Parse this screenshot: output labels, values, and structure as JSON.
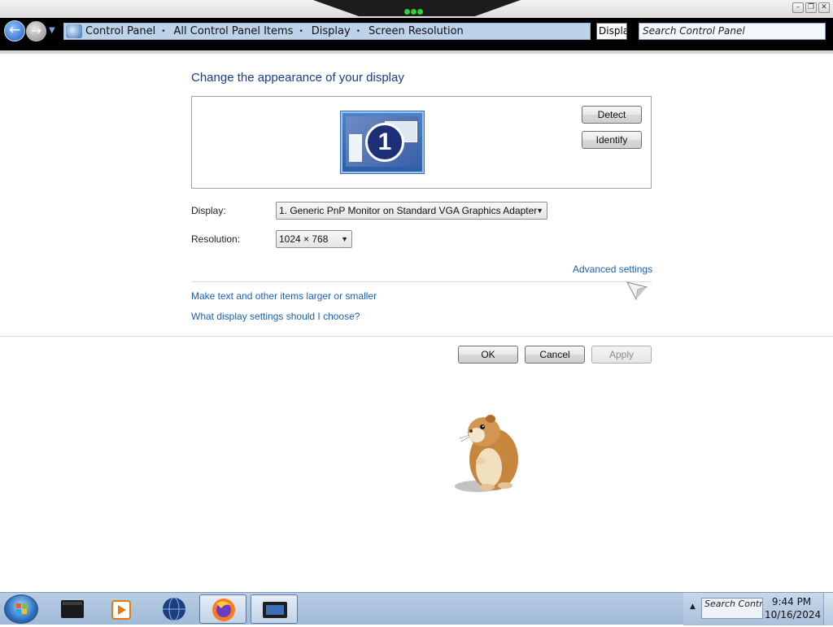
{
  "window": {
    "minimize_glyph": "–",
    "maximize_glyph": "❐",
    "close_glyph": "✕"
  },
  "address_bar": {
    "back_glyph": "←",
    "forward_glyph": "→",
    "history_glyph": "▼",
    "breadcrumb": [
      "Control Panel",
      "All Control Panel Items",
      "Display",
      "Screen Resolution"
    ],
    "separator": "•",
    "refresh_text": "Displa",
    "search_value": "Search Control Panel"
  },
  "main": {
    "title": "Change the appearance of your display",
    "monitor_number": "1",
    "detect_label": "Detect",
    "identify_label": "Identify",
    "display_label": "Display:",
    "display_value": "1. Generic PnP Monitor on Standard VGA Graphics Adapter",
    "resolution_label": "Resolution:",
    "resolution_value": "1024 × 768",
    "advanced_link": "Advanced settings",
    "text_size_link": "Make text and other items larger or smaller",
    "help_link": "What display settings should I choose?",
    "ok_label": "OK",
    "cancel_label": "Cancel",
    "apply_label": "Apply"
  },
  "taskbar": {
    "tray_search": "Search Control",
    "time": "9:44 PM",
    "date": "10/16/2024",
    "tray_arrow": "▲"
  },
  "colors": {
    "link": "#1a5fb4",
    "title": "#1e3a8a",
    "address_bar_bg": "#000000",
    "breadcrumb_bg": "#bdd3ea",
    "taskbar_bg": "#a9c0da"
  },
  "icons": {
    "start": "windows-start-orb",
    "taskbar_apps": [
      "terminal-window-icon",
      "media-player-icon",
      "globe-browser-icon",
      "firefox-icon",
      "display-window-icon"
    ],
    "overlay": [
      "arrow-cursor-icon",
      "hamster-icon"
    ]
  }
}
